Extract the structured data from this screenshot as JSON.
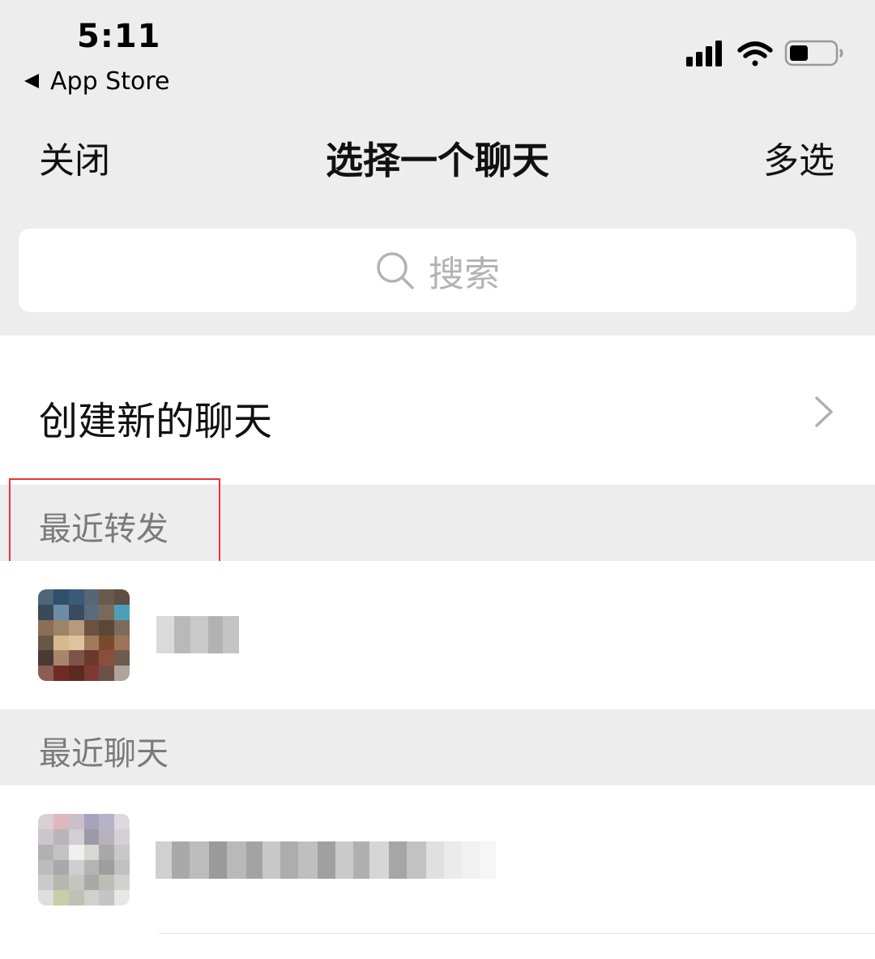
{
  "status_bar": {
    "time": "5:11",
    "back_label": "App Store"
  },
  "nav": {
    "close_label": "关闭",
    "title": "选择一个聊天",
    "multi_select_label": "多选"
  },
  "search": {
    "placeholder": "搜索"
  },
  "new_chat": {
    "label": "创建新的聊天"
  },
  "sections": {
    "recent_forward": "最近转发",
    "recent_chats": "最近聊天"
  },
  "icons": {
    "search": "search-icon",
    "chevron": "chevron-right-icon",
    "back": "back-triangle-icon",
    "signal": "cellular-signal-icon",
    "wifi": "wifi-icon",
    "battery": "battery-icon"
  },
  "colors": {
    "background_gray": "#ededed",
    "highlight_box": "#e33333",
    "placeholder": "#b3b3b3",
    "section_text": "#7a7a7a"
  }
}
